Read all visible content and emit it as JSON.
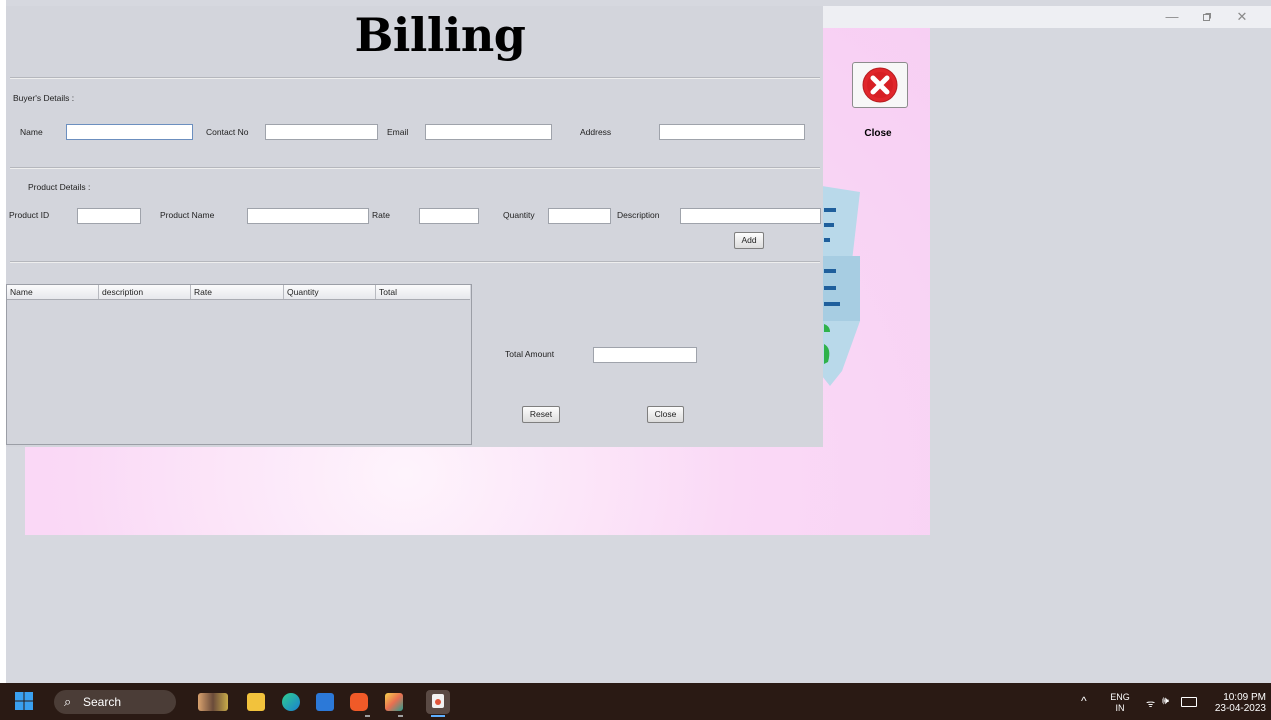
{
  "billing": {
    "title": "Billing",
    "buyer_section_label": "Buyer's Details :",
    "product_section_label": "Product Details :",
    "fields": {
      "name": {
        "label": "Name",
        "value": ""
      },
      "contact": {
        "label": "Contact No",
        "value": ""
      },
      "email": {
        "label": "Email",
        "value": ""
      },
      "address": {
        "label": "Address",
        "value": ""
      },
      "product_id": {
        "label": "Product ID",
        "value": ""
      },
      "product_name": {
        "label": "Product Name",
        "value": ""
      },
      "rate": {
        "label": "Rate",
        "value": ""
      },
      "quantity": {
        "label": "Quantity",
        "value": ""
      },
      "description": {
        "label": "Description",
        "value": ""
      },
      "total_amount": {
        "label": "Total Amount",
        "value": ""
      }
    },
    "buttons": {
      "add": "Add",
      "reset": "Reset",
      "close": "Close"
    },
    "table": {
      "columns": [
        "Name",
        "description",
        "Rate",
        "Quantity",
        "Total"
      ],
      "rows": []
    }
  },
  "background_window": {
    "close_label": "Close",
    "close_icon": "red-x-circle-icon"
  },
  "outer_window_controls": [
    "minimize",
    "restore",
    "close"
  ],
  "taskbar": {
    "search_label": "Search",
    "apps": [
      "start-icon",
      "search-icon",
      "user-widget-icon",
      "file-explorer-icon",
      "edge-icon",
      "microsoft-store-icon",
      "brave-icon",
      "app-cube-icon",
      "java-icon"
    ],
    "tray": {
      "lang_top": "ENG",
      "lang_bottom": "IN",
      "time": "10:09 PM",
      "date": "23-04-2023"
    }
  },
  "colors": {
    "desktop": "#d6d8df",
    "billing_window": "#d3d5dc",
    "pink_window": "#f8d4f4",
    "close_icon_red": "#e0262b",
    "taskbar": "#2a1a14"
  }
}
